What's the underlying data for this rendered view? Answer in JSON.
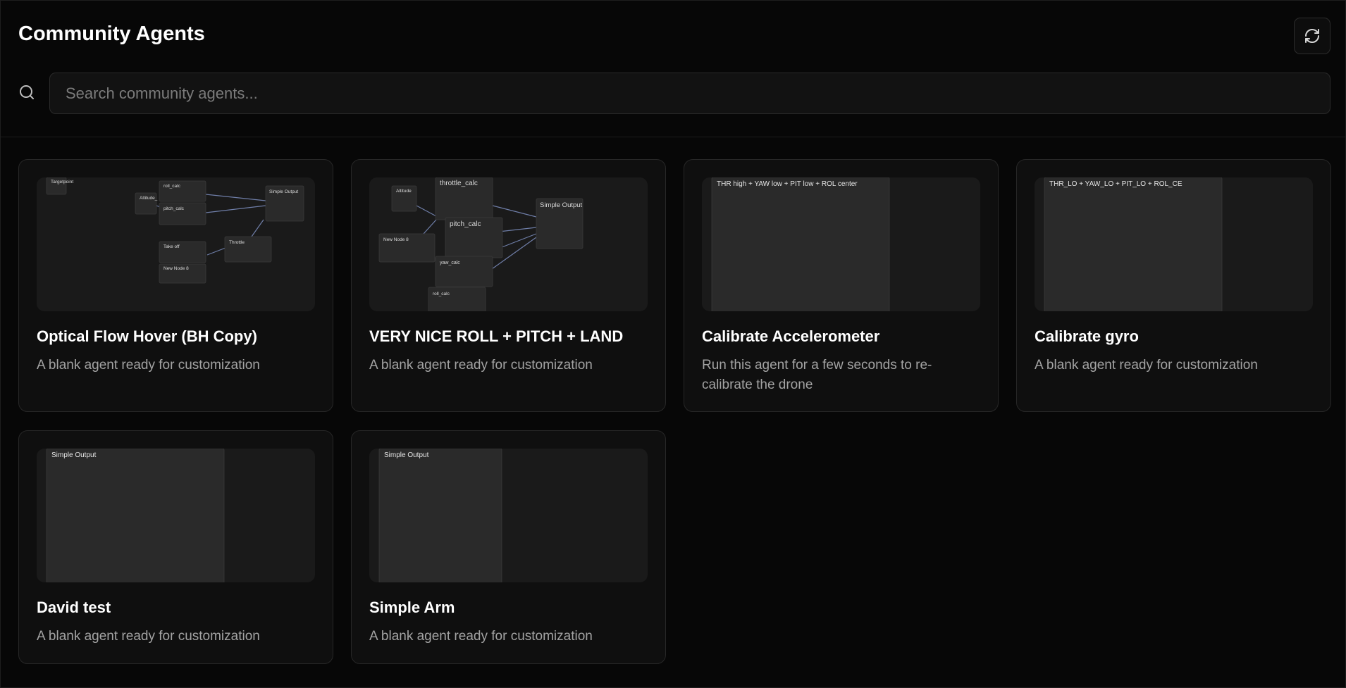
{
  "header": {
    "title": "Community Agents",
    "refresh_icon": "refresh-icon"
  },
  "search": {
    "icon": "search-icon",
    "placeholder": "Search community agents..."
  },
  "agents": [
    {
      "title": "Optical Flow Hover (BH Copy)",
      "description": "A blank agent ready for customization",
      "preview_nodes": [
        "Targetpoint",
        "Altitude_",
        "roll_calc",
        "pitch_calc",
        "Simple Output",
        "Throttle",
        "Take off",
        "New Node 8"
      ]
    },
    {
      "title": "VERY NICE ROLL + PITCH + LAND",
      "description": "A blank agent ready for customization",
      "preview_nodes": [
        "Altitude",
        "throttle_calc",
        "pitch_calc",
        "Simple Output",
        "New Node 8",
        "yaw_calc",
        "roll_calc"
      ]
    },
    {
      "title": "Calibrate Accelerometer",
      "description": "Run this agent for a few seconds to re-calibrate the drone",
      "preview_nodes": [
        "THR high + YAW low + PIT low + ROL center"
      ]
    },
    {
      "title": "Calibrate gyro",
      "description": "A blank agent ready for customization",
      "preview_nodes": [
        "THR_LO + YAW_LO + PIT_LO + ROL_CE"
      ]
    },
    {
      "title": "David test",
      "description": "A blank agent ready for customization",
      "preview_nodes": [
        "Simple Output"
      ]
    },
    {
      "title": "Simple Arm",
      "description": "A blank agent ready for customization",
      "preview_nodes": [
        "Simple Output"
      ]
    }
  ],
  "colors": {
    "background": "#070707",
    "card": "#0f0f0f",
    "preview": "#1a1a1a",
    "node": "#2a2a2a",
    "edge": "#6f7ea8"
  }
}
